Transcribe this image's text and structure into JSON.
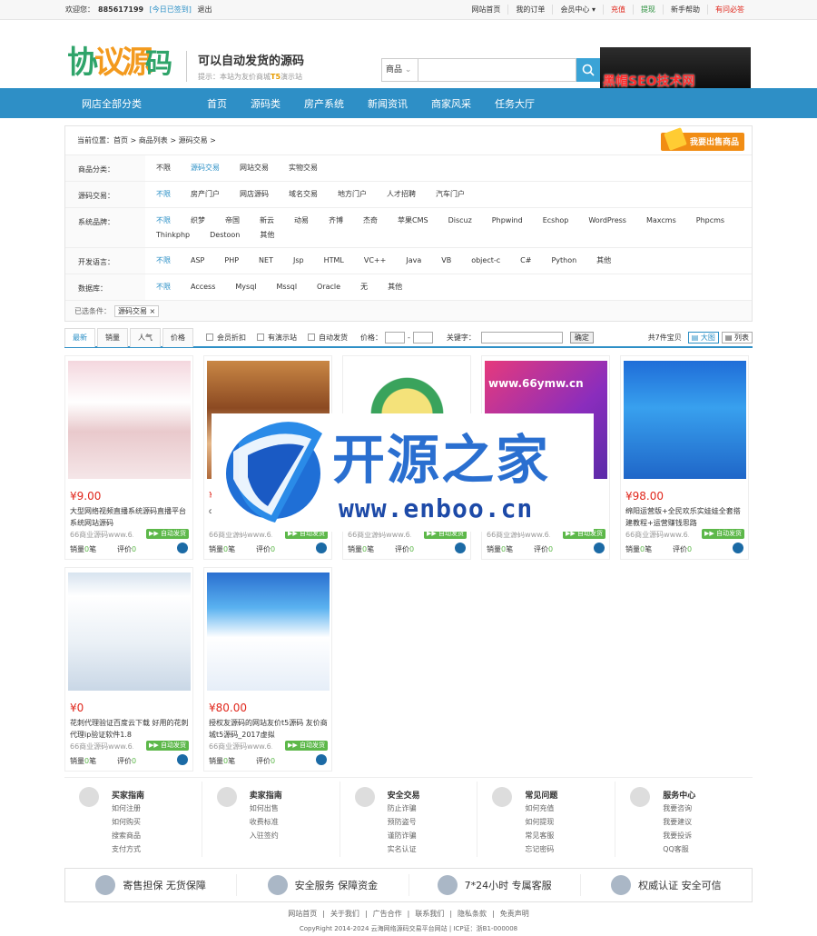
{
  "topbar": {
    "welcome": "欢迎您：",
    "uid": "885617199",
    "checkin": "[今日已签到]",
    "logout": "退出",
    "links": [
      "网站首页",
      "我的订单",
      "会员中心 ▾",
      "充值",
      "提现",
      "新手帮助",
      "有问必答"
    ]
  },
  "header": {
    "logo_text": "协议源码",
    "slogan_title": "可以自动发货的源码",
    "slogan_tip_pre": "提示：本站为友价商城",
    "slogan_tip_mid": "T5",
    "slogan_tip_post": "演示站",
    "search_select": "商品",
    "banner_text": "黑帽SEO技术网"
  },
  "nav": {
    "all": "网店全部分类",
    "items": [
      "首页",
      "源码类",
      "房产系统",
      "新闻资讯",
      "商家风采",
      "任务大厅"
    ]
  },
  "filter": {
    "crumb": "当前位置：首页 > 商品列表 > 源码交易 >",
    "sell_button": "我要出售商品",
    "rows": [
      {
        "label": "商品分类：",
        "options": [
          "不限",
          "源码交易",
          "网站交易",
          "实物交易"
        ],
        "active": 1
      },
      {
        "label": "源码交易：",
        "options": [
          "不限",
          "房产门户",
          "网店源码",
          "域名交易",
          "地方门户",
          "人才招聘",
          "汽车门户"
        ],
        "active": 0
      },
      {
        "label": "系统品牌：",
        "options": [
          "不限",
          "织梦",
          "帝国",
          "新云",
          "动易",
          "齐博",
          "杰奇",
          "苹果CMS",
          "Discuz",
          "Phpwind",
          "Ecshop",
          "WordPress",
          "Maxcms",
          "Phpcms",
          "Thinkphp",
          "Destoon",
          "其他"
        ],
        "active": 0
      },
      {
        "label": "开发语言：",
        "options": [
          "不限",
          "ASP",
          "PHP",
          "NET",
          "Jsp",
          "HTML",
          "VC++",
          "Java",
          "VB",
          "object-c",
          "C#",
          "Python",
          "其他"
        ],
        "active": 0
      },
      {
        "label": "数据库：",
        "options": [
          "不限",
          "Access",
          "Mysql",
          "Mssql",
          "Oracle",
          "无",
          "其他"
        ],
        "active": 0
      }
    ],
    "selected_label": "已选条件：",
    "selected_tag": "源码交易 ×"
  },
  "sortbar": {
    "tabs": [
      "最新",
      "销量",
      "人气",
      "价格"
    ],
    "checks": [
      "会员折扣",
      "有演示站",
      "自动发货"
    ],
    "price_label": "价格：",
    "dash": "-",
    "keyword_label": "关键字：",
    "confirm": "确定",
    "count": "共7件宝贝",
    "view_big": "▤ 大图",
    "view_list": "▤ 列表"
  },
  "products": [
    {
      "price": "¥9.00",
      "title": "大型网络视频直播系统源码直播平台系统网站源码",
      "shop": "66商业源码www.6...",
      "auto": "▶▶ 自动发货",
      "sales": "销量",
      "sales_n": "0",
      "sales_u": "笔",
      "rate": "评价",
      "rate_n": "0"
    },
    {
      "price": "¥0",
      "title": "cpav...",
      "shop": "66商业源码www.6...",
      "auto": "▶▶ 自动发货",
      "sales": "销量",
      "sales_n": "0",
      "sales_u": "笔",
      "rate": "评价",
      "rate_n": "0"
    },
    {
      "price": "",
      "title": "",
      "shop": "66商业源码www.6...",
      "auto": "▶▶ 自动发货",
      "sales": "销量",
      "sales_n": "0",
      "sales_u": "笔",
      "rate": "评价",
      "rate_n": "0"
    },
    {
      "price": "",
      "title": "",
      "shop": "66商业源码www.6...",
      "auto": "▶▶ 自动发货",
      "sales": "销量",
      "sales_n": "0",
      "sales_u": "笔",
      "rate": "评价",
      "rate_n": "0"
    },
    {
      "price": "¥98.00",
      "title": "绵阳运营版+全民欢乐实娃娃全套搭建教程+运营赚钱思路",
      "shop": "66商业源码www.6...",
      "auto": "▶▶ 自动发货",
      "sales": "销量",
      "sales_n": "0",
      "sales_u": "笔",
      "rate": "评价",
      "rate_n": "0"
    },
    {
      "price": "¥0",
      "title": "花刺代理验证百度云下载 好用的花刺代理ip验证软件1.8",
      "shop": "66商业源码www.6...",
      "auto": "▶▶ 自动发货",
      "sales": "销量",
      "sales_n": "0",
      "sales_u": "笔",
      "rate": "评价",
      "rate_n": "0"
    },
    {
      "price": "¥80.00",
      "title": "授权友源码的网站友价t5源码 友价商城t5源码_2017虚拟",
      "shop": "66商业源码www.6...",
      "auto": "▶▶ 自动发货",
      "sales": "销量",
      "sales_n": "0",
      "sales_u": "笔",
      "rate": "评价",
      "rate_n": "0"
    }
  ],
  "watermark": {
    "title": "开源之家",
    "url": "www.enboo.cn",
    "img_banner": "www.66ymw.cn"
  },
  "help": [
    {
      "title": "买家指南",
      "links": [
        "如何注册",
        "如何购买",
        "搜索商品",
        "支付方式"
      ]
    },
    {
      "title": "卖家指南",
      "links": [
        "如何出售",
        "收费标准",
        "入驻签约"
      ]
    },
    {
      "title": "安全交易",
      "links": [
        "防止诈骗",
        "预防盗号",
        "谨防诈骗",
        "实名认证"
      ]
    },
    {
      "title": "常见问题",
      "links": [
        "如何充值",
        "如何提现",
        "常见客服",
        "忘记密码"
      ]
    },
    {
      "title": "服务中心",
      "links": [
        "我要咨询",
        "我要建议",
        "我要投诉",
        "QQ客服"
      ]
    }
  ],
  "promise": [
    "寄售担保  无货保障",
    "安全服务  保障资金",
    "7*24小时  专属客服",
    "权威认证  安全可信"
  ],
  "footer": {
    "links": [
      "网站首页",
      "|",
      "关于我们",
      "|",
      "广告合作",
      "|",
      "联系我们",
      "|",
      "隐私条款",
      "|",
      "免责声明"
    ],
    "copy": "CopyRight 2014-2024 云海网络源码交易平台网站 | ICP证：浙B1-000008"
  },
  "colors": {
    "accent": "#2e8fc6",
    "price": "#e0271c",
    "auto": "#5db84a",
    "sell": "#f18d14"
  }
}
